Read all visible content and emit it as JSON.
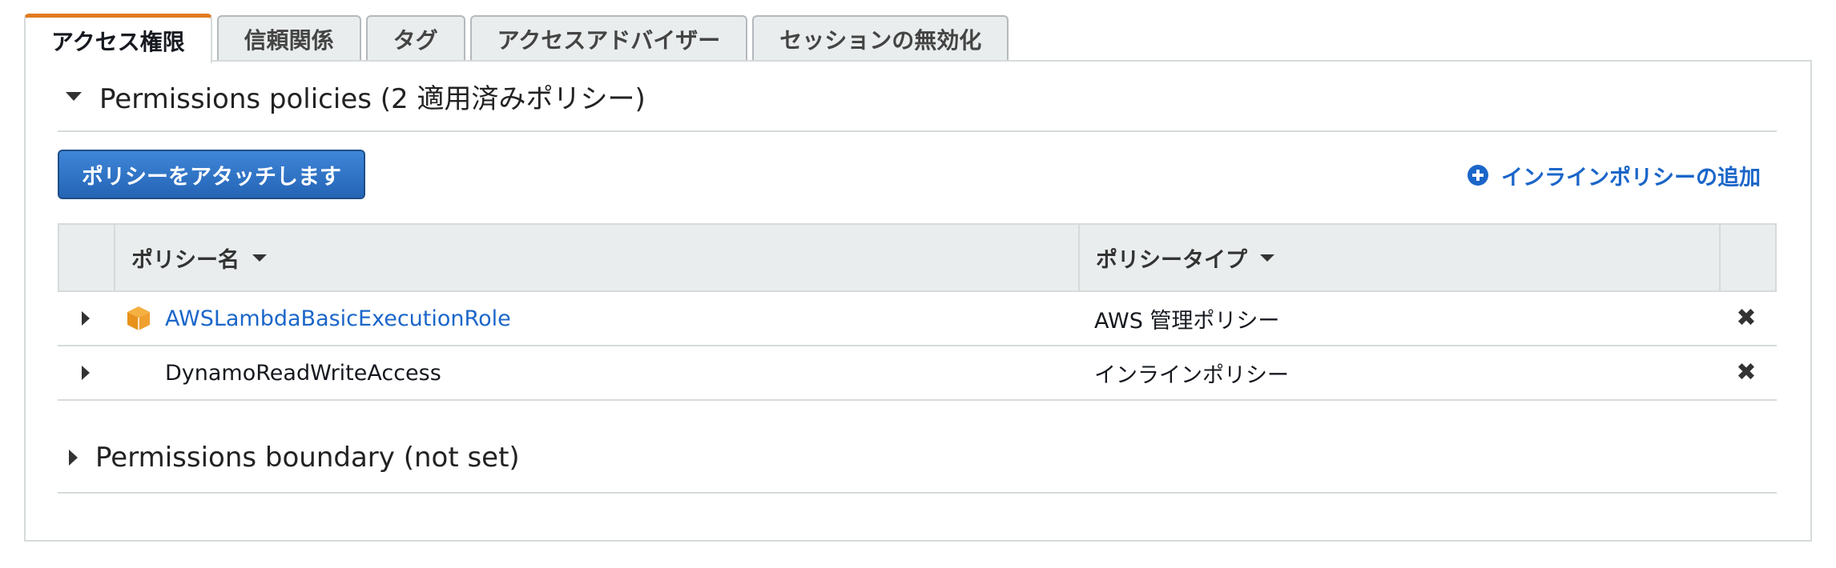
{
  "tabs": [
    {
      "label": "アクセス権限",
      "active": true
    },
    {
      "label": "信頼関係",
      "active": false
    },
    {
      "label": "タグ",
      "active": false
    },
    {
      "label": "アクセスアドバイザー",
      "active": false
    },
    {
      "label": "セッションの無効化",
      "active": false
    }
  ],
  "policies_section": {
    "title": "Permissions policies (2 適用済みポリシー)",
    "attach_button": "ポリシーをアタッチします",
    "add_inline": "インラインポリシーの追加",
    "columns": {
      "name": "ポリシー名",
      "type": "ポリシータイプ"
    },
    "rows": [
      {
        "name": "AWSLambdaBasicExecutionRole",
        "type": "AWS 管理ポリシー",
        "icon": "aws-managed-policy-cube-icon",
        "link": true
      },
      {
        "name": "DynamoReadWriteAccess",
        "type": "インラインポリシー",
        "icon": "",
        "link": false
      }
    ]
  },
  "boundary_section": {
    "title": "Permissions boundary (not set)"
  },
  "colors": {
    "active_tab_accent": "#e07b1f",
    "primary_button": "#2a6ec2",
    "link": "#1b66c9",
    "cube_icon": "#f0a030"
  }
}
